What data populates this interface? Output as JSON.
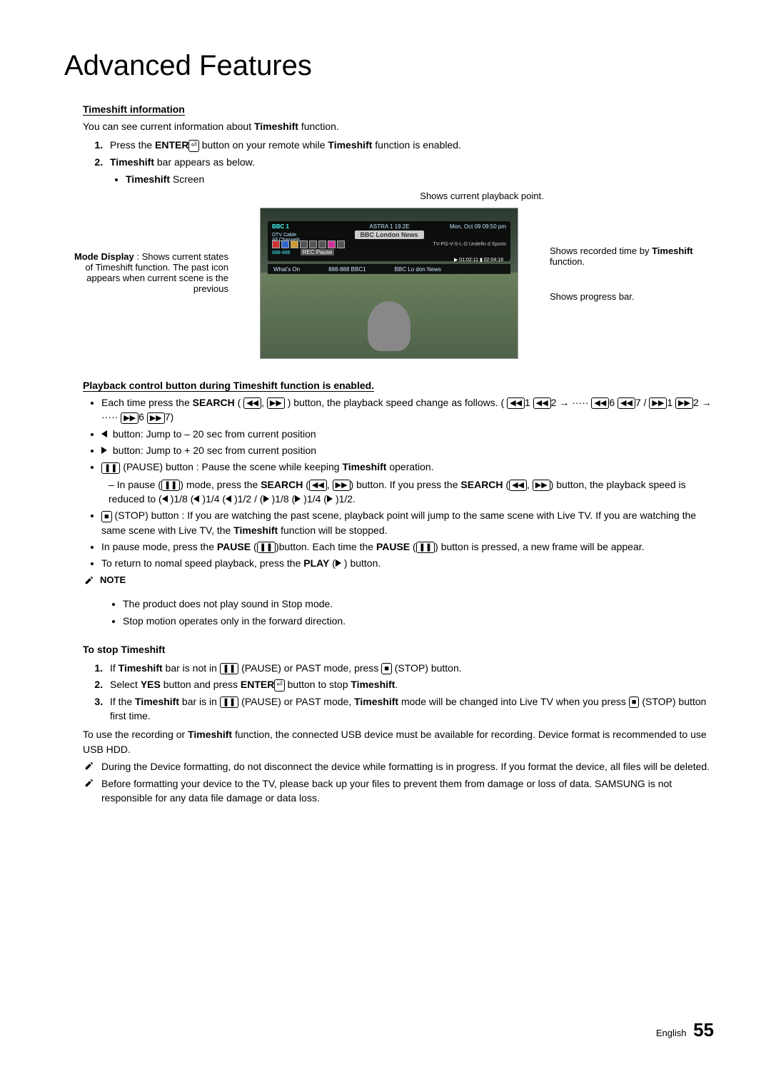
{
  "title": "Advanced Features",
  "timeshift_info": {
    "heading": "Timeshift information",
    "intro_a": "You can see current information about ",
    "intro_b": "Timeshift",
    "intro_c": " function.",
    "steps": [
      {
        "pre": "Press the ",
        "b1": "ENTER",
        "post": " button on your remote while ",
        "b2": "Timeshift",
        "post2": " function is enabled."
      },
      {
        "b1": "Timeshift",
        "post": " bar appears as below."
      }
    ],
    "sub_bullet_b": "Timeshift",
    "sub_bullet_post": " Screen"
  },
  "figure": {
    "top_callout": "Shows current playback point.",
    "left_b": "Mode Display",
    "left_rest": " : Shows current states of Timeshift function. The past icon appears when current scene is the previous",
    "right1_a": "Shows recorded time by ",
    "right1_b": "Timeshift",
    "right1_c": " function.",
    "right2": "Shows progress bar.",
    "osd": {
      "ch": "BBC 1",
      "dtv": "DTV Cable",
      "all": "All Channels",
      "prog": "BBC London News",
      "astra": "ASTRA 1 19.2E",
      "date": "Mon, Oct 09 09:50 pm",
      "rating": "TV-PG-V-S-L-D Undefin d Sports",
      "rec": "REC Pause",
      "time1": "01:02:11",
      "time2": "02:04:18",
      "whatson": "What's On",
      "row_a": "888-888 BBC1",
      "row_b": "BBC Lo don News"
    }
  },
  "playback": {
    "heading": "Playback control button during Timeshift function is enabled.",
    "b_search_a": "Each time press the ",
    "b_search": "SEARCH",
    "b_search_b": " (",
    "b_speed": ") button, the playback speed change as follows. (",
    "seq1": "1 ",
    "seq2": "2 → ····· ",
    "seq6": "6 ",
    "seq7": "7",
    "seq_div": " / ",
    "jump_back": " button: Jump to – 20 sec from current position",
    "jump_fwd": " button: Jump to + 20 sec from current position",
    "pause_a": " (PAUSE) button : Pause the scene while keeping ",
    "pause_b": "Timeshift",
    "pause_c": " operation.",
    "pause_sub_a": "In pause (",
    "pause_sub_b": ") mode, press the ",
    "pause_sub_c": " (",
    "pause_sub_d": ") button. If you press the ",
    "pause_sub_e": " (",
    "pause_sub_f": ") button, the playback speed is reduced to (",
    "pause_speeds": ")1/8 (",
    "pause_speeds2": ")1/4 (",
    "pause_speeds3": ")1/2 / (",
    "pause_speeds4": ")1/8 (",
    "pause_speeds5": ")1/4 (",
    "pause_speeds6": ")1/2.",
    "stop_a": " (STOP) button : If you are watching the past scene, playback point will jump to the same scene with Live TV. If you are watching the same scene with Live TV, the ",
    "stop_b": "Timeshift",
    "stop_c": " function will be stopped.",
    "pausemode_a": "In pause mode, press the ",
    "pausemode_b": "PAUSE",
    "pausemode_c": " (",
    "pausemode_d": ")button. Each time the ",
    "pausemode_e": "PAUSE",
    "pausemode_f": " (",
    "pausemode_g": ") button is pressed, a new frame will be appear.",
    "return_a": "To return to nomal speed playback, press the ",
    "return_b": "PLAY",
    "return_c": " (",
    "return_d": ") button.",
    "note_label": "NOTE",
    "note1": "The product does not play sound in Stop mode.",
    "note2": "Stop motion operates only in the forward direction."
  },
  "stop": {
    "heading": "To stop Timeshift",
    "s1_a": "If ",
    "s1_b": "Timeshift",
    "s1_c": " bar is not in ",
    "s1_d": " (PAUSE) or PAST mode, press ",
    "s1_e": " (STOP) button.",
    "s2_a": "Select ",
    "s2_b": "YES",
    "s2_c": " button and press ",
    "s2_d": "ENTER",
    "s2_e": " button to stop ",
    "s2_f": "Timeshift",
    "s2_g": ".",
    "s3_a": "If the ",
    "s3_b": "Timeshift",
    "s3_c": " bar is in ",
    "s3_d": " (PAUSE) or PAST mode, ",
    "s3_e": "Timeshift",
    "s3_f": " mode will be changed into Live TV when you press ",
    "s3_g": " (STOP) button first time.",
    "para_a": "To use the recording or ",
    "para_b": "Timeshift",
    "para_c": " function, the connected USB device must be available for recording. Device format is recommended to use USB HDD.",
    "tip1": "During the Device formatting, do not disconnect the device while formatting is in progress. If you format the device, all files will be deleted.",
    "tip2": "Before formatting your device to the TV, please back up your files to prevent them from damage or loss of data. SAMSUNG is not responsible for any data file damage or data loss."
  },
  "footer": {
    "lang": "English",
    "page": "55"
  }
}
